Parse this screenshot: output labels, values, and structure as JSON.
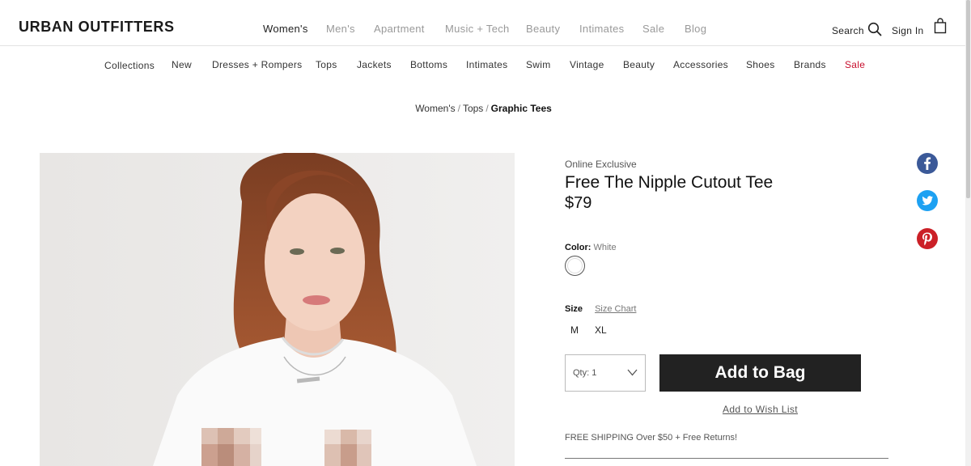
{
  "brand": {
    "logo": "URBAN OUTFITTERS"
  },
  "main_nav": [
    {
      "label": "Women's",
      "active": true
    },
    {
      "label": "Men's",
      "active": false
    },
    {
      "label": "Apartment",
      "active": false
    },
    {
      "label": "Music + Tech",
      "active": false
    },
    {
      "label": "Beauty",
      "active": false
    },
    {
      "label": "Intimates",
      "active": false
    },
    {
      "label": "Sale",
      "active": false
    },
    {
      "label": "Blog",
      "active": false
    }
  ],
  "utility": {
    "search_label": "Search",
    "signin_label": "Sign In"
  },
  "sub_nav": [
    "Collections",
    "New",
    "Dresses + Rompers",
    "Tops",
    "Jackets",
    "Bottoms",
    "Intimates",
    "Swim",
    "Vintage",
    "Beauty",
    "Accessories",
    "Shoes",
    "Brands",
    "Sale"
  ],
  "breadcrumb": {
    "level1": "Women's",
    "level2": "Tops",
    "current": "Graphic Tees",
    "separator": "/"
  },
  "product": {
    "badge": "Online Exclusive",
    "title": "Free The Nipple Cutout Tee",
    "price": "$79",
    "color_label": "Color:",
    "color_value": "White",
    "size_label": "Size",
    "size_chart_label": "Size Chart",
    "sizes": [
      "M",
      "XL"
    ],
    "qty_label": "Qty: 1",
    "add_to_bag_label": "Add to Bag",
    "wish_list_label": "Add to Wish List",
    "shipping_text": "FREE SHIPPING Over $50 + Free Returns!"
  },
  "social": [
    "facebook-icon",
    "twitter-icon",
    "pinterest-icon"
  ],
  "colors": {
    "facebook": "#3b5998",
    "twitter": "#1da1f2",
    "pinterest": "#cb2027",
    "sale": "#c8102e",
    "button": "#222222"
  }
}
